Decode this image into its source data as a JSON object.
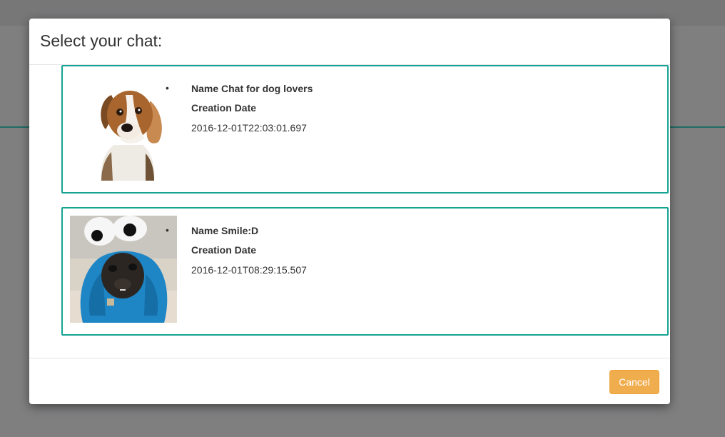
{
  "modal": {
    "title": "Select your chat:",
    "cancel_label": "Cancel"
  },
  "chats": [
    {
      "name": "Name Chat for dog lovers",
      "creation_label": "Creation Date",
      "creation_date": "2016-12-01T22:03:01.697",
      "image": "beagle-photo"
    },
    {
      "name": "Name Smile:D",
      "creation_label": "Creation Date",
      "creation_date": "2016-12-01T08:29:15.507",
      "image": "pug-in-blue-monster-costume-photo"
    }
  ],
  "colors": {
    "accent_border": "#16a392",
    "cancel_button": "#f0ad4e",
    "backdrop": "#7f7f80"
  }
}
